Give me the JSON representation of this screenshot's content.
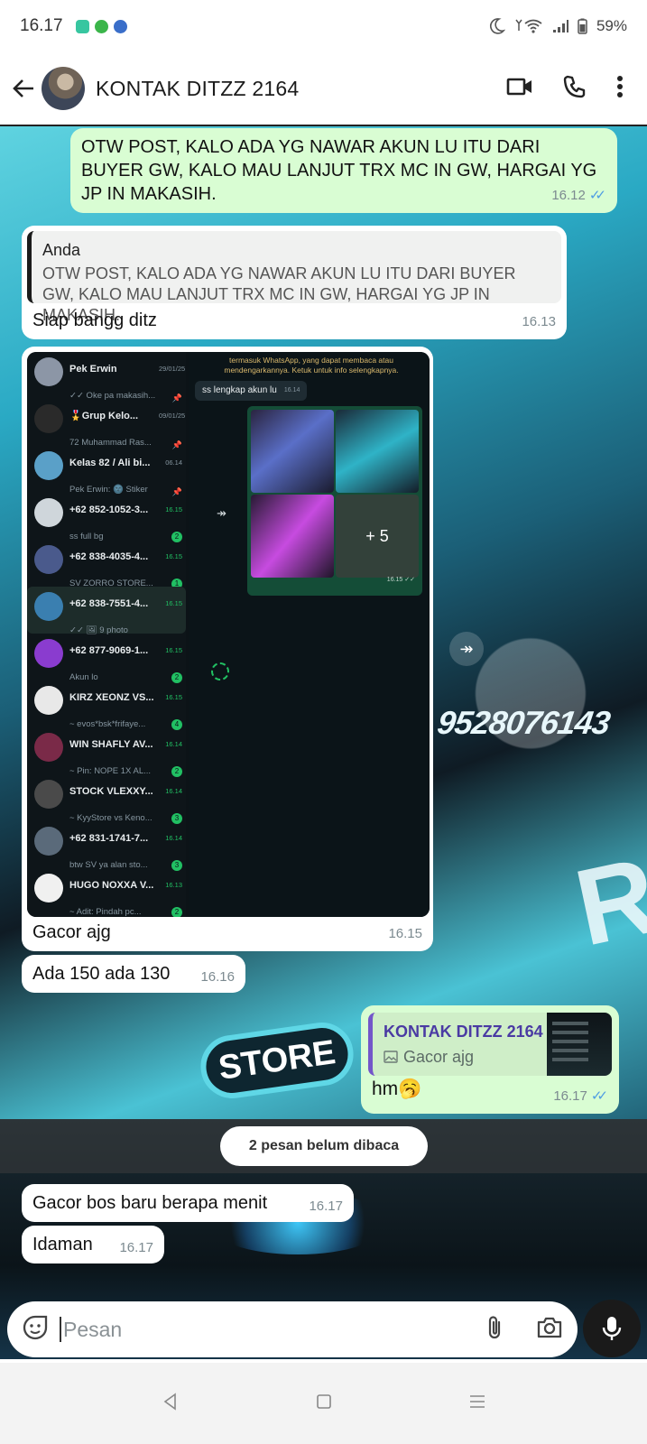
{
  "status_bar": {
    "time": "16.17",
    "battery": "59%"
  },
  "header": {
    "contact_name": "KONTAK DITZZ 2164"
  },
  "messages": {
    "m1": {
      "text": "OTW POST, KALO ADA YG NAWAR AKUN LU ITU DARI BUYER GW, KALO MAU LANJUT TRX MC IN GW, HARGAI YG JP IN MAKASIH.",
      "time": "16.12"
    },
    "m2": {
      "quote_author": "Anda",
      "quote_text": "OTW POST, KALO ADA YG NAWAR AKUN LU ITU DARI BUYER GW, KALO MAU LANJUT TRX MC IN GW, HARGAI YG JP IN MAKASIH.",
      "text": "Siap bangg ditz",
      "time": "16.13"
    },
    "m3": {
      "caption": "Gacor ajg",
      "time": "16.15"
    },
    "m4": {
      "text": "Ada 150 ada 130",
      "time": "16.16"
    },
    "m5": {
      "reply_author": "KONTAK DITZZ 2164",
      "reply_text": "Gacor ajg",
      "text": "hm🥱",
      "time": "16.17"
    },
    "m6": {
      "text": "Gacor bos baru berapa menit",
      "time": "16.17"
    },
    "m7": {
      "text": "Idaman",
      "time": "16.17"
    }
  },
  "unread_banner": "2 pesan belum dibaca",
  "screenshot": {
    "chats": [
      {
        "name": "Pek Erwin",
        "sub": "✓✓ Oke pa makasih...",
        "time": "29/01/25",
        "badge": ""
      },
      {
        "name": "🎖️Grup Kelo...",
        "sub": "72 Muhammad Ras...",
        "time": "09/01/25",
        "badge": ""
      },
      {
        "name": "Kelas 82 / Ali bi...",
        "sub": "Pek Erwin: 🌚 Stiker",
        "time": "06.14",
        "badge": ""
      },
      {
        "name": "+62 852-1052-3...",
        "sub": "ss full bg",
        "time": "16.15",
        "badge": "2"
      },
      {
        "name": "+62 838-4035-4...",
        "sub": "SV ZORRO STORE...",
        "time": "16.15",
        "badge": "1"
      },
      {
        "name": "+62 838-7551-4...",
        "sub": "✓✓ 🖼 9 photo",
        "time": "16.15",
        "badge": ""
      },
      {
        "name": "+62 877-9069-1...",
        "sub": "Akun lo",
        "time": "16.15",
        "badge": "2"
      },
      {
        "name": "KIRZ XEONZ VS...",
        "sub": "~ evos*bsk*frifaye...",
        "time": "16.15",
        "badge": "4"
      },
      {
        "name": "WIN SHAFLY AV...",
        "sub": "~ Pin: NOPE 1X AL...",
        "time": "16.14",
        "badge": "2"
      },
      {
        "name": "STOCK VLEXXY...",
        "sub": "~ KyyStore vs Keno...",
        "time": "16.14",
        "badge": "3"
      },
      {
        "name": "+62 831-1741-7...",
        "sub": "btw SV ya alan sto...",
        "time": "16.14",
        "badge": "3"
      },
      {
        "name": "HUGO NOXXA V...",
        "sub": "~ Adit: Pindah pc...",
        "time": "16.13",
        "badge": "2"
      }
    ],
    "notice": "termasuk WhatsApp, yang dapat membaca atau mendengarkannya. Ketuk untuk info selengkapnya.",
    "msg_text": "ss lengkap akun lu",
    "msg_time": "16.14",
    "more_count": "+ 5",
    "grid_time": "16.15 ✓✓"
  },
  "background_text": {
    "number": "9528076143",
    "store": "STORE"
  },
  "input": {
    "placeholder": "Pesan"
  },
  "colors": {
    "outgoing_bubble": "#d9fdd3",
    "incoming_bubble": "#ffffff",
    "read_ticks": "#4e9de3"
  }
}
